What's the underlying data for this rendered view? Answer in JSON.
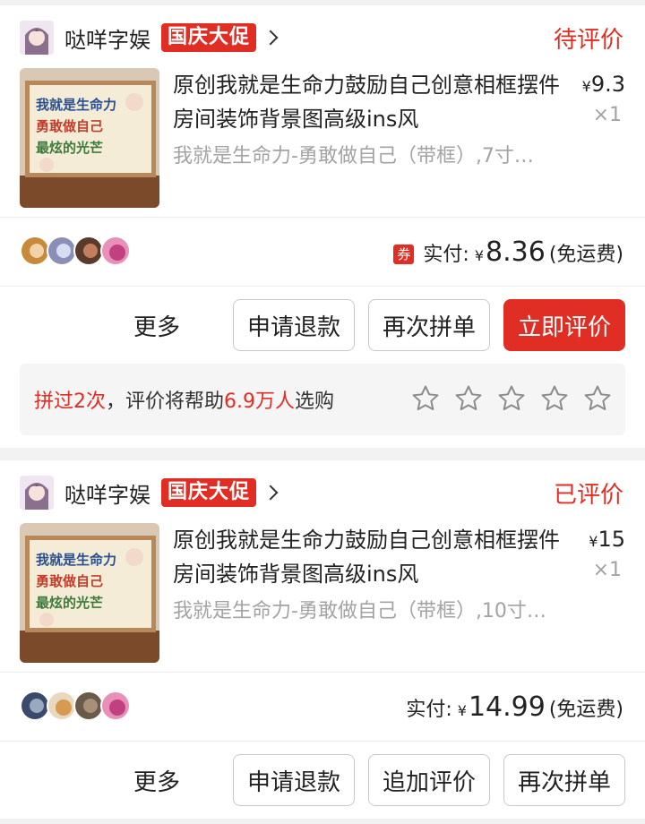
{
  "orders": [
    {
      "shop_name": "哒咩字娱",
      "promo": "国庆大促",
      "status": "待评价",
      "title": "原创我就是生命力鼓励自己创意相框摆件房间装饰背景图高级ins风",
      "spec": "我就是生命力-勇敢做自己（带框）,7寸…",
      "price_symbol": "¥",
      "price": "9.3",
      "qty": "×1",
      "coupon": "券",
      "paid_label": "实付:",
      "paid_symbol": "¥",
      "paid_amount": "8.36",
      "shipping": "(免运费)",
      "buttons": {
        "more": "更多",
        "refund": "申请退款",
        "reorder": "再次拼单",
        "review": "立即评价"
      },
      "hint": {
        "prefix": "拼过2次",
        "middle": "，评价将帮助",
        "count": "6.9万人",
        "suffix": "选购"
      },
      "rating_stars": 0
    },
    {
      "shop_name": "哒咩字娱",
      "promo": "国庆大促",
      "status": "已评价",
      "title": "原创我就是生命力鼓励自己创意相框摆件房间装饰背景图高级ins风",
      "spec": "我就是生命力-勇敢做自己（带框）,10寸…",
      "price_symbol": "¥",
      "price": "15",
      "qty": "×1",
      "paid_label": "实付:",
      "paid_symbol": "¥",
      "paid_amount": "14.99",
      "shipping": "(免运费)",
      "buttons": {
        "more": "更多",
        "refund": "申请退款",
        "add_review": "追加评价",
        "reorder": "再次拼单"
      }
    }
  ],
  "colors": {
    "accent": "#e02e24",
    "muted": "#a3a3a3",
    "background": "#f2f2f2"
  }
}
